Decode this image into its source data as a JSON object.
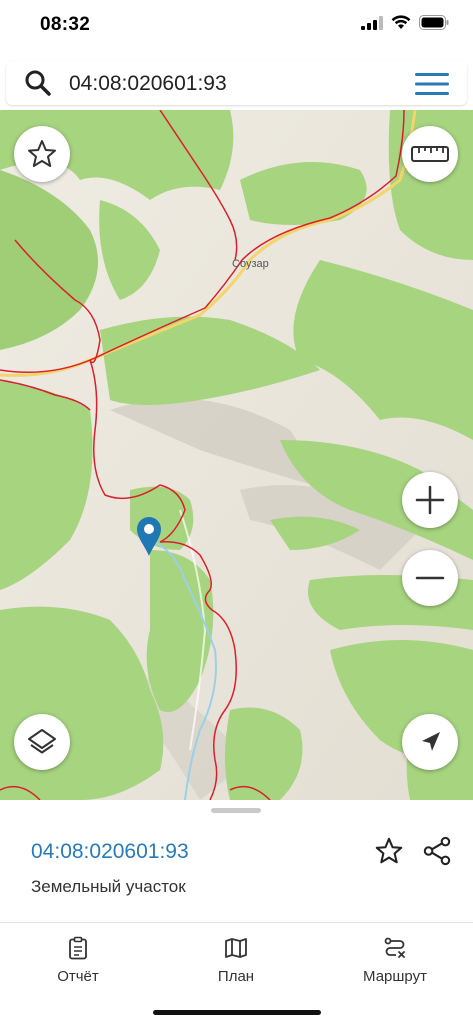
{
  "status_bar": {
    "time": "08:32"
  },
  "search": {
    "query": "04:08:020601:93"
  },
  "map": {
    "place_label": "Соузар"
  },
  "colors": {
    "accent": "#2a7ab8",
    "terrain_green": "#a7d47f",
    "boundary_red": "#d9202b",
    "road_yellow": "#f2d56b"
  },
  "parcel": {
    "cadastral_number": "04:08:020601:93",
    "type": "Земельный участок"
  },
  "tabs": [
    {
      "label": "Отчёт",
      "icon": "report-icon"
    },
    {
      "label": "План",
      "icon": "map-plan-icon"
    },
    {
      "label": "Маршрут",
      "icon": "route-icon"
    }
  ]
}
